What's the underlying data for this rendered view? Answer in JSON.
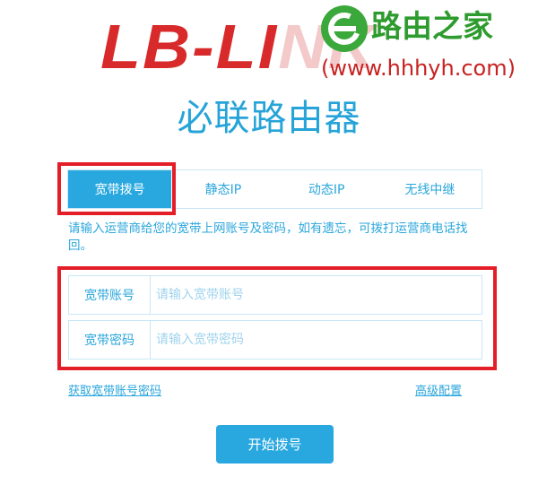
{
  "logo": {
    "text_main": "LB-LI",
    "text_faded": "NK"
  },
  "watermark": {
    "title": "路由之家",
    "url": "(www.hhhyh.com)"
  },
  "page_title": "必联路由器",
  "tabs": [
    {
      "label": "宽带拨号",
      "active": true
    },
    {
      "label": "静态IP",
      "active": false
    },
    {
      "label": "动态IP",
      "active": false
    },
    {
      "label": "无线中继",
      "active": false
    }
  ],
  "hint": "请输入运营商给您的宽带上网账号及密码，如有遗忘，可拨打运营商电话找回。",
  "form": {
    "account": {
      "label": "宽带账号",
      "placeholder": "请输入宽带账号"
    },
    "password": {
      "label": "宽带密码",
      "placeholder": "请输入宽带密码"
    }
  },
  "links": {
    "retrieve": "获取宽带账号密码",
    "advanced": "高级配置"
  },
  "start_button": "开始拨号",
  "colors": {
    "accent": "#29a8e0",
    "highlight": "#e41e28",
    "logo": "#d82a2a"
  }
}
